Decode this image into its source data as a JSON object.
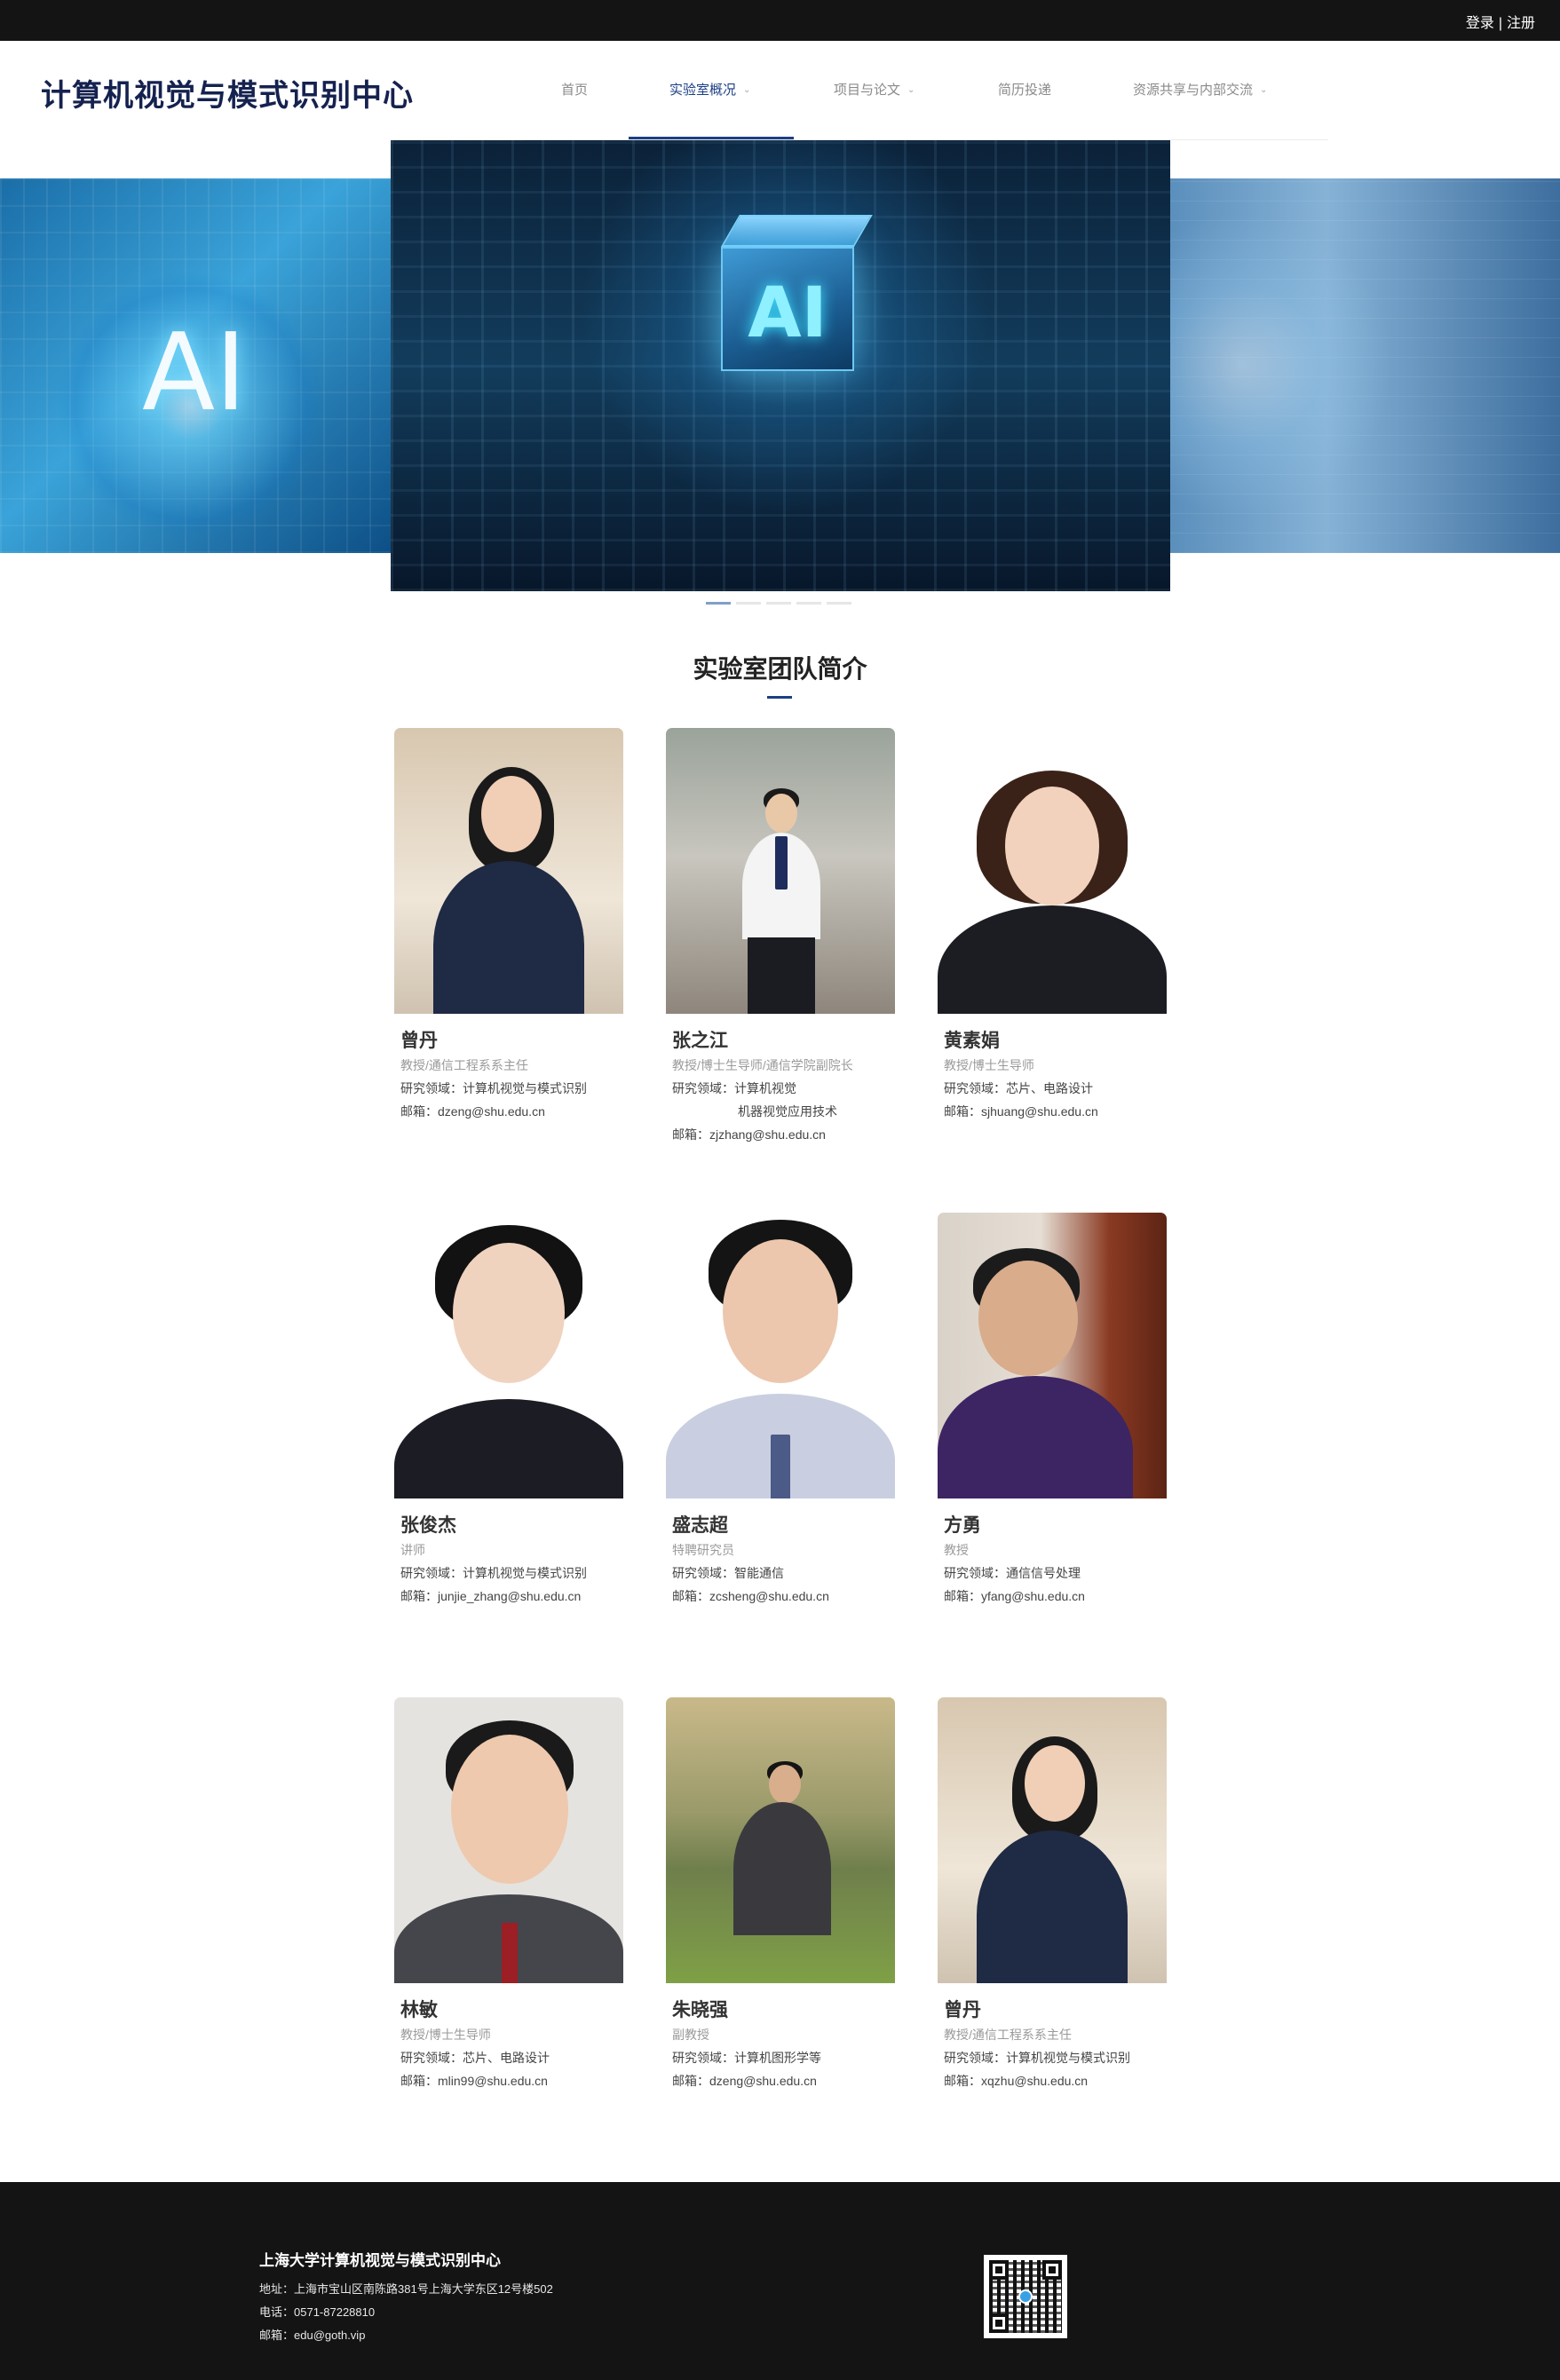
{
  "topbar": {
    "login": "登录",
    "separator": "|",
    "register": "注册"
  },
  "header": {
    "site_title": "计算机视觉与模式识别中心"
  },
  "nav": {
    "items": [
      {
        "label": "首页",
        "dropdown": ""
      },
      {
        "label": "实验室概况",
        "dropdown": "⌄"
      },
      {
        "label": "项目与论文",
        "dropdown": "⌄"
      },
      {
        "label": "简历投递",
        "dropdown": ""
      },
      {
        "label": "资源共享与内部交流",
        "dropdown": "⌄"
      }
    ],
    "active_index": 1
  },
  "hero": {
    "left_slide_text": "AI",
    "main_slide_text": "AI",
    "slides_count": 5,
    "active_slide": 0
  },
  "section": {
    "title": "实验室团队简介"
  },
  "team": [
    {
      "name": "曾丹",
      "title": "教授/通信工程系系主任",
      "lines": [
        "研究领域：计算机视觉与模式识别",
        "邮箱：dzeng@shu.edu.cn"
      ]
    },
    {
      "name": "张之江",
      "title": "教授/博士生导师/通信学院副院长",
      "lines": [
        "研究领域：计算机视觉",
        "机器视觉应用技术",
        "邮箱：zjzhang@shu.edu.cn"
      ]
    },
    {
      "name": "黄素娟",
      "title": "教授/博士生导师",
      "lines": [
        "研究领域：芯片、电路设计",
        "邮箱：sjhuang@shu.edu.cn"
      ]
    },
    {
      "name": "张俊杰",
      "title": "讲师",
      "lines": [
        "研究领域：计算机视觉与模式识别",
        "邮箱：junjie_zhang@shu.edu.cn"
      ]
    },
    {
      "name": "盛志超",
      "title": "特聘研究员",
      "lines": [
        "研究领域：智能通信",
        "邮箱：zcsheng@shu.edu.cn"
      ]
    },
    {
      "name": "方勇",
      "title": "教授",
      "lines": [
        "研究领域：通信信号处理",
        "邮箱：yfang@shu.edu.cn"
      ]
    },
    {
      "name": "林敏",
      "title": "教授/博士生导师",
      "lines": [
        "研究领域：芯片、电路设计",
        "邮箱：mlin99@shu.edu.cn"
      ]
    },
    {
      "name": "朱晓强",
      "title": "副教授",
      "lines": [
        "研究领域：计算机图形学等",
        "邮箱：dzeng@shu.edu.cn"
      ]
    },
    {
      "name": "曾丹",
      "title": "教授/通信工程系系主任",
      "lines": [
        "研究领域：计算机视觉与模式识别",
        "邮箱：xqzhu@shu.edu.cn"
      ]
    }
  ],
  "footer": {
    "org": "上海大学计算机视觉与模式识别中心",
    "address": "地址：上海市宝山区南陈路381号上海大学东区12号楼502",
    "phone": "电话：0571-87228810",
    "email": "邮箱：edu@goth.vip"
  },
  "colors": {
    "topbar": "#141414",
    "brand": "#15224f",
    "accent": "#1c3f84",
    "footer": "#141414"
  },
  "icons": {
    "nav_dropdown": "chevron-down-icon",
    "footer_qr": "qr-code-icon"
  }
}
